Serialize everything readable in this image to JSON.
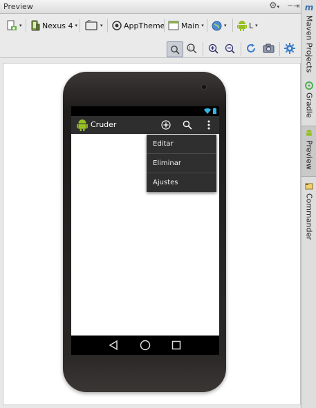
{
  "panel": {
    "title": "Preview"
  },
  "toolbar": {
    "device": "Nexus 4",
    "theme": "AppTheme",
    "activity": "Main",
    "api": "L"
  },
  "sidebar": {
    "maven": "Maven Projects",
    "gradle": "Gradle",
    "preview": "Preview",
    "commander": "Commander"
  },
  "app": {
    "title": "Cruder",
    "menu": [
      "Editar",
      "Eliminar",
      "Ajustes"
    ]
  },
  "colors": {
    "actionbar": "#2e2e2e",
    "android_green": "#97c024",
    "accent_blue": "#3a7dc9"
  },
  "icons": [
    "settings-icon",
    "pin-icon",
    "new-layout-icon",
    "device-icon",
    "orientation-icon",
    "theme-icon",
    "activity-icon",
    "locale-icon",
    "android-icon",
    "zoom-fit-icon",
    "zoom-actual-icon",
    "zoom-in-icon",
    "zoom-out-icon",
    "refresh-icon",
    "screenshot-icon",
    "add-icon",
    "search-icon",
    "overflow-icon",
    "wifi-icon",
    "battery-icon",
    "back-icon",
    "home-icon",
    "recents-icon"
  ]
}
